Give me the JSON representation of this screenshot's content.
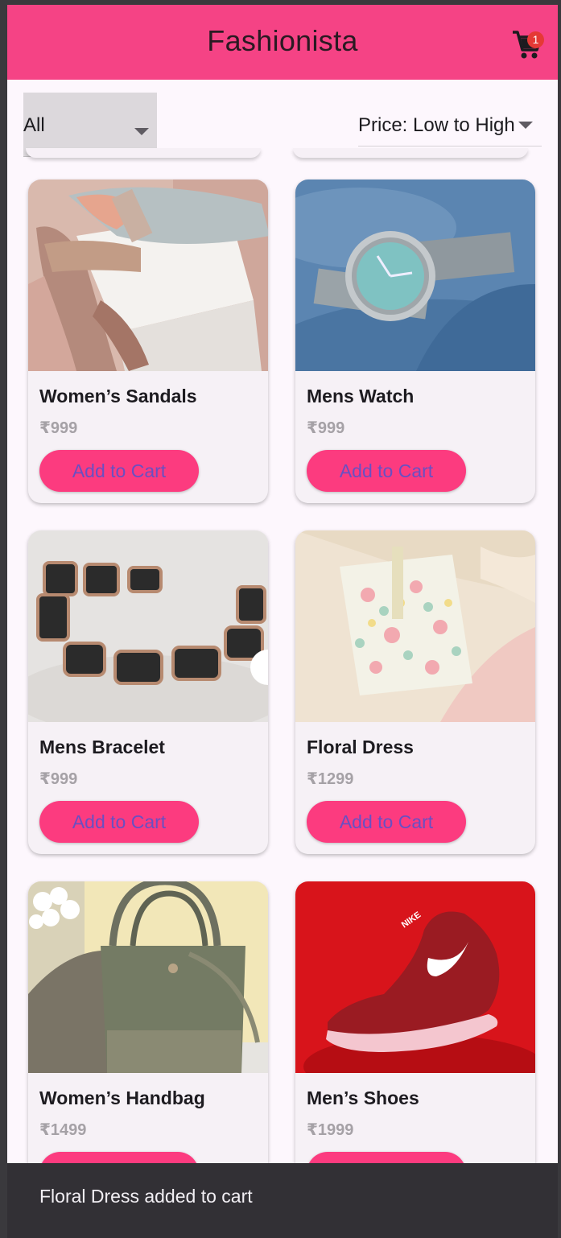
{
  "app": {
    "title": "Fashionista",
    "cart_count": "1"
  },
  "filters": {
    "category": "All",
    "sort": "Price: Low to High"
  },
  "products": [
    {
      "name": "Women’s Sandals",
      "price": "₹999",
      "button": "Add to Cart"
    },
    {
      "name": "Mens Watch",
      "price": "₹999",
      "button": "Add to Cart"
    },
    {
      "name": "Mens Bracelet",
      "price": "₹999",
      "button": "Add to Cart"
    },
    {
      "name": "Floral Dress",
      "price": "₹1299",
      "button": "Add to Cart"
    },
    {
      "name": "Women’s Handbag",
      "price": "₹1499",
      "button": "Add to Cart"
    },
    {
      "name": "Men’s Shoes",
      "price": "₹1999",
      "button": "Add to Cart"
    }
  ],
  "snackbar": {
    "message": "Floral Dress added to cart"
  },
  "colors": {
    "appbar": "#f54385",
    "button": "#fc3b7f",
    "button_text": "#6a4fc2",
    "badge": "#e53935",
    "snackbar": "#323035"
  },
  "icons": {
    "cart": "shopping-cart-icon",
    "dropdown": "arrow-drop-down-icon"
  }
}
